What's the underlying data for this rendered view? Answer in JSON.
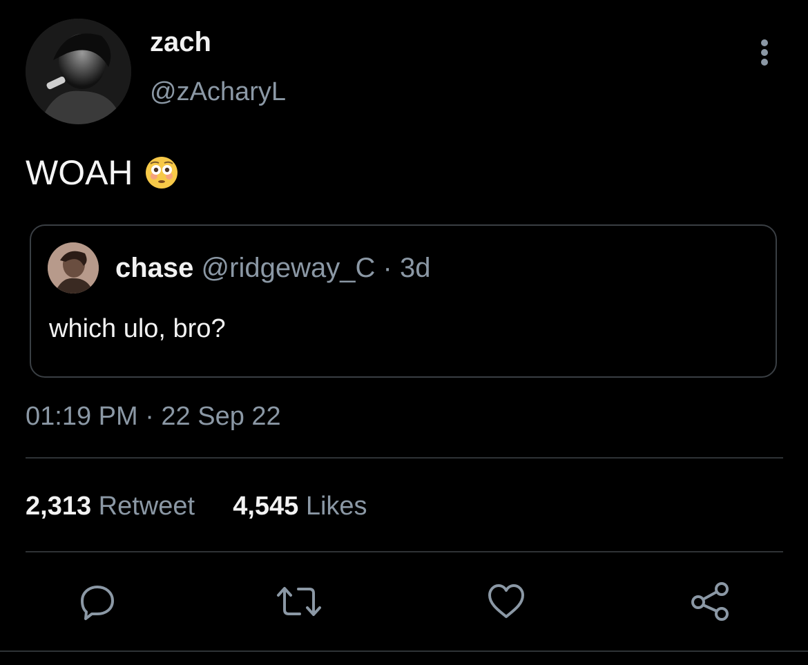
{
  "tweet": {
    "display_name": "zach",
    "handle": "@zAcharyL",
    "text": "WOAH",
    "emoji": "flushed-face-emoji",
    "timestamp": "01:19 PM · 22 Sep 22"
  },
  "quote": {
    "display_name": "chase",
    "handle": "@ridgeway_C",
    "separator": "·",
    "time": "3d",
    "text": "which ulo, bro?"
  },
  "stats": {
    "retweets_count": "2,313",
    "retweets_label": "Retweet",
    "likes_count": "4,545",
    "likes_label": "Likes"
  },
  "actions": {
    "reply": "reply-icon",
    "retweet": "retweet-icon",
    "like": "heart-icon",
    "share": "share-icon",
    "more": "more-vertical-icon"
  },
  "colors": {
    "background": "#000000",
    "primary_text": "#e7e9ea",
    "secondary_text": "#8b98a5",
    "border": "#2f3336"
  }
}
